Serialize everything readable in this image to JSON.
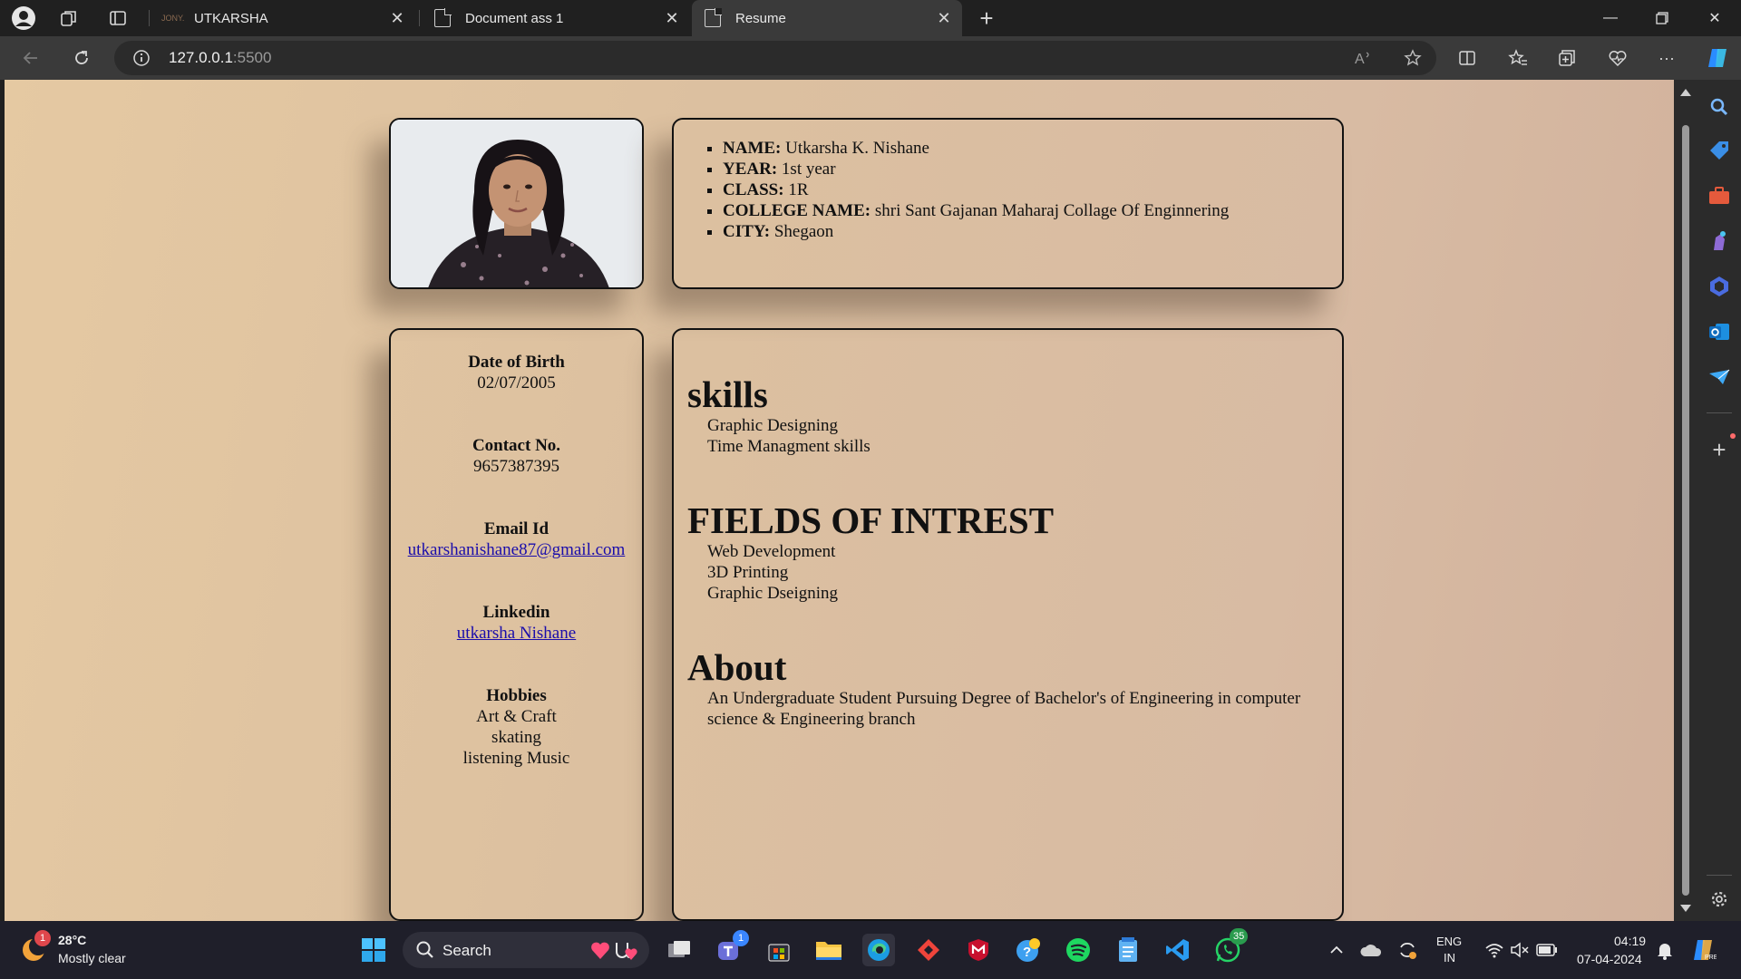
{
  "browser": {
    "tabs": [
      {
        "label": "UTKARSHA",
        "active": false
      },
      {
        "label": "Document ass 1",
        "active": false
      },
      {
        "label": "Resume",
        "active": true
      }
    ],
    "url_host": "127.0.0.1",
    "url_port": ":5500",
    "new_tab_symbol": "+"
  },
  "resume": {
    "info": [
      {
        "label": "NAME:",
        "value": " Utkarsha K. Nishane"
      },
      {
        "label": "YEAR:",
        "value": " 1st year"
      },
      {
        "label": "CLASS:",
        "value": " 1R"
      },
      {
        "label": "COLLEGE NAME:",
        "value": " shri Sant Gajanan Maharaj Collage Of Enginnering"
      },
      {
        "label": "CITY:",
        "value": " Shegaon"
      }
    ],
    "contact": {
      "dob_label": "Date of Birth",
      "dob_value": "02/07/2005",
      "phone_label": "Contact No.",
      "phone_value": "9657387395",
      "email_label": "Email Id",
      "email_value": "utkarshanishane87@gmail.com",
      "linkedin_label": "Linkedin",
      "linkedin_value": "utkarsha Nishane",
      "hobbies_label": "Hobbies",
      "hobbies": [
        "Art & Craft",
        "skating",
        "listening Music"
      ]
    },
    "skills_title": "skills",
    "skills": [
      "Graphic Designing",
      "Time Managment skills"
    ],
    "interests_title": "FIELDS OF INTREST",
    "interests": [
      "Web Development",
      "3D Printing",
      "Graphic Dseigning"
    ],
    "about_title": "About",
    "about_line1": "An Undergraduate Student Pursuing Degree of Bachelor's of Engineering in computer",
    "about_line2": "science & Engineering branch"
  },
  "taskbar": {
    "weather_temp": "28°C",
    "weather_desc": "Mostly clear",
    "weather_badge": "1",
    "search_label": "Search",
    "teams_badge": "1",
    "whatsapp_badge": "35",
    "lang_1": "ENG",
    "lang_2": "IN",
    "time": "04:19",
    "date": "07-04-2024"
  }
}
